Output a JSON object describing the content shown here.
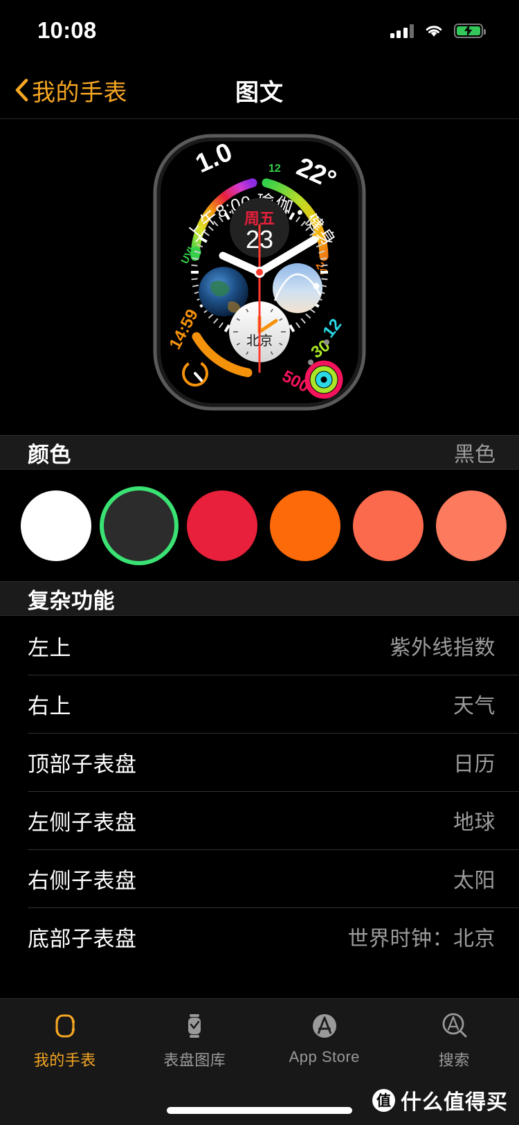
{
  "statusbar": {
    "time": "10:08",
    "signal_icon": "cellular-signal-icon",
    "signal_bars_filled": 3,
    "signal_bars_total": 4,
    "wifi_icon": "wifi-icon",
    "battery_icon": "battery-charging-icon",
    "battery_color": "#34c759"
  },
  "navbar": {
    "back_icon": "chevron-left-icon",
    "back_label": "我的手表",
    "title": "图文",
    "accent": "#f5a623"
  },
  "watch_preview": {
    "name": "apple-watch-face-preview",
    "face_name": "图文",
    "uv": {
      "label": "UVI",
      "value": "1.0"
    },
    "weather": {
      "value": "22°",
      "scale_min": "12",
      "scale_max": "24"
    },
    "calendar_event": "上午8:00 瑜伽 • 健身房",
    "date_subdial": {
      "weekday": "周五",
      "day": "23"
    },
    "left_subdial": "地球",
    "right_subdial": "太阳",
    "bottom_subdial": {
      "city": "北京"
    },
    "timer": "14:59",
    "activity": {
      "move": "500",
      "exercise": "30",
      "stand": "12"
    }
  },
  "color_section": {
    "title": "颜色",
    "selected_label": "黑色",
    "selected_index": 1,
    "swatches": [
      {
        "name": "白色",
        "hex": "#ffffff"
      },
      {
        "name": "黑色",
        "hex": "#2c2c2c"
      },
      {
        "name": "红色",
        "hex": "#e8203c"
      },
      {
        "name": "橙色",
        "hex": "#fc6a09"
      },
      {
        "name": "珊瑚色",
        "hex": "#fc6a4d"
      },
      {
        "name": "浅珊瑚色",
        "hex": "#fc7a5d"
      }
    ],
    "selection_ring_color": "#3ae173"
  },
  "complications_section": {
    "title": "复杂功能",
    "rows": [
      {
        "label": "左上",
        "value": "紫外线指数"
      },
      {
        "label": "右上",
        "value": "天气"
      },
      {
        "label": "顶部子表盘",
        "value": "日历"
      },
      {
        "label": "左侧子表盘",
        "value": "地球"
      },
      {
        "label": "右侧子表盘",
        "value": "太阳"
      },
      {
        "label": "底部子表盘",
        "value": "世界时钟：北京"
      }
    ]
  },
  "tabbar": {
    "items": [
      {
        "label": "我的手表",
        "icon": "watch-icon",
        "active": true
      },
      {
        "label": "表盘图库",
        "icon": "watch-faces-gallery-icon",
        "active": false
      },
      {
        "label": "App Store",
        "icon": "app-store-icon",
        "active": false
      },
      {
        "label": "搜索",
        "icon": "search-icon",
        "active": false
      }
    ],
    "active_color": "#f5a623",
    "inactive_color": "#9a9a9a"
  },
  "watermark": {
    "logo": "值",
    "text": "什么值得买"
  }
}
